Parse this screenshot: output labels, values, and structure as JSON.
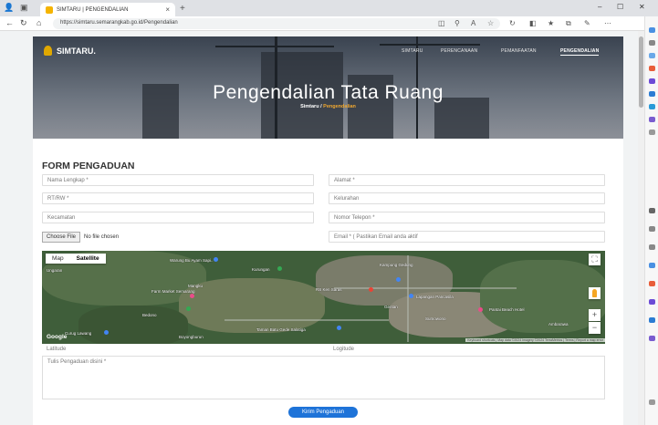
{
  "browser": {
    "tab_title": "SIMTARU | PENGENDALIAN",
    "tab_close": "×",
    "new_tab": "+",
    "url": "https://simtaru.semarangkab.go.id/Pengendalian",
    "window_min": "–",
    "window_max": "☐",
    "window_close": "✕"
  },
  "header": {
    "logo_text": "SIMTARU.",
    "nav": [
      "SIMTARU",
      "PERENCANAAN",
      "PEMANFAATAN",
      "PENGENDALIAN"
    ],
    "active_nav": "PENGENDALIAN"
  },
  "hero": {
    "title": "Pengendalian Tata Ruang",
    "crumb_home": "Simtaru",
    "crumb_sep": "/",
    "crumb_current": "Pengendalian"
  },
  "form": {
    "title": "FORM PENGADUAN",
    "fields": {
      "nama": "Nama Lengkap *",
      "alamat": "Alamat *",
      "rtrw": "RT/RW *",
      "kelurahan": "Kelurahan",
      "kecamatan": "Kecamatan",
      "telepon": "Nomor Telepon *",
      "email": "Email * ( Pastikan Email anda aktif"
    },
    "file_button": "Choose File",
    "file_status": "No file chosen",
    "latitude": "Latitude",
    "longitude": "Logitude",
    "complaint": "Tulis Pengaduan disini *",
    "submit": "Kirim Pengaduan"
  },
  "map": {
    "type_map": "Map",
    "type_satellite": "Satellite",
    "fullscreen": "⛶",
    "zoom_in": "+",
    "zoom_out": "−",
    "google": "Google",
    "attribution": "Keyboard shortcuts | Map data ©2024 Imagery ©2024 TerraMetrics | Terms | Report a map error",
    "labels": {
      "warung": "Warung Bu Ayam Sapi..",
      "kurungan": "Kurungan",
      "ungaran": "Ungaran",
      "kampung": "Kampung Gedung",
      "mangku": "Mangku",
      "farm": "Farm Market Semarang",
      "rs": "RS Ken Saras",
      "pancasila": "Lapangan Pancasila",
      "gentan": "Gentan",
      "pantai": "Pantai Beach Hotel",
      "temaran": "Taman Batu Gede Salatiga",
      "curug": "Curug Lawang",
      "bedono": "Bedono",
      "bojong": "Boyongburun",
      "jp": "Jogjakarta",
      "sumo": "Sumowono",
      "ambarawa": "Ambarawa"
    }
  },
  "colors": {
    "accent": "#1e73d8",
    "crumb_current": "#f0a830",
    "logo_mark": "#e0a800"
  }
}
